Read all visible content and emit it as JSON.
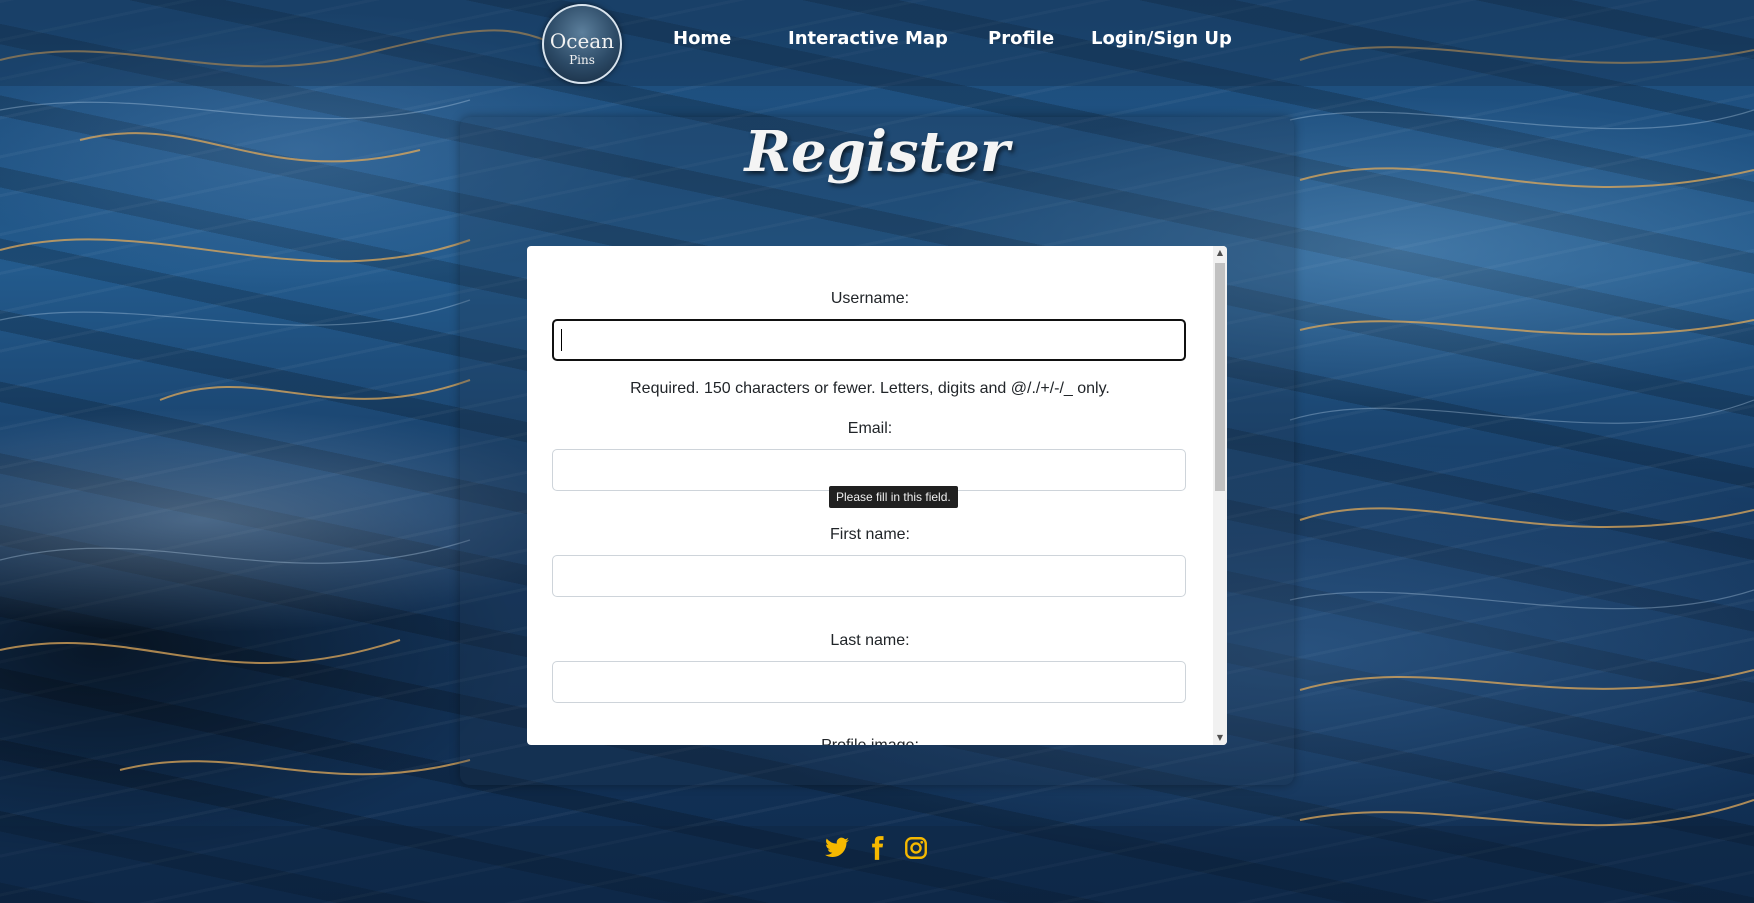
{
  "nav": {
    "logo_line1": "Ocean",
    "logo_line2": "Pins",
    "links": [
      {
        "label": "Home"
      },
      {
        "label": "Interactive Map"
      },
      {
        "label": "Profile"
      },
      {
        "label": "Login/Sign Up"
      }
    ]
  },
  "page": {
    "title": "Register"
  },
  "form": {
    "username_label": "Username:",
    "username_value": "",
    "username_help": "Required. 150 characters or fewer. Letters, digits and @/./+/-/_ only.",
    "email_label": "Email:",
    "email_value": "",
    "tooltip": "Please fill in this field.",
    "first_name_label": "First name:",
    "first_name_value": "",
    "last_name_label": "Last name:",
    "last_name_value": "",
    "profile_image_label": "Profile image:"
  },
  "footer": {
    "icons": [
      "twitter-icon",
      "facebook-icon",
      "instagram-icon"
    ],
    "icon_color": "#f5b800"
  },
  "colors": {
    "nav_text": "#ffffff",
    "card_bg": "#ffffff",
    "focus_border": "#111111"
  }
}
